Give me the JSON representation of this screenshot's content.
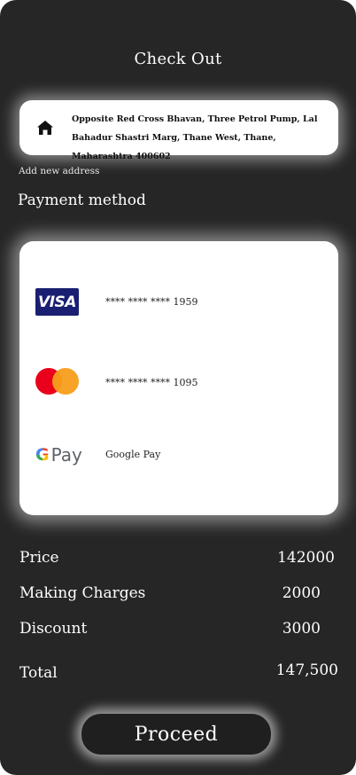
{
  "header": {
    "title": "Check Out"
  },
  "address": {
    "icon": "home-icon",
    "text": "Opposite Red Cross Bhavan, Three Petrol Pump, Lal Bahadur Shastri Marg, Thane West, Thane, Maharashtra 400602",
    "add_new_label": "Add new address"
  },
  "payment": {
    "section_title": "Payment method",
    "methods": [
      {
        "brand": "visa-logo",
        "logo_text": "VISA",
        "label": "**** **** **** 1959"
      },
      {
        "brand": "mastercard-logo",
        "label": "**** **** **** 1095"
      },
      {
        "brand": "google-pay-logo",
        "logo_text": "Pay",
        "logo_g": "G",
        "label": "Google Pay"
      }
    ]
  },
  "summary": {
    "price_label": "Price",
    "price_value": "142000",
    "making_label": "Making Charges",
    "making_value": "2000",
    "discount_label": "Discount",
    "discount_value": "3000",
    "total_label": "Total",
    "total_value": "147,500"
  },
  "actions": {
    "proceed_label": "Proceed"
  },
  "colors": {
    "background": "#262626",
    "card": "#ffffff",
    "visa_blue": "#1a1f71",
    "mc_red": "#eb001b",
    "mc_yellow": "#f79e1b"
  }
}
